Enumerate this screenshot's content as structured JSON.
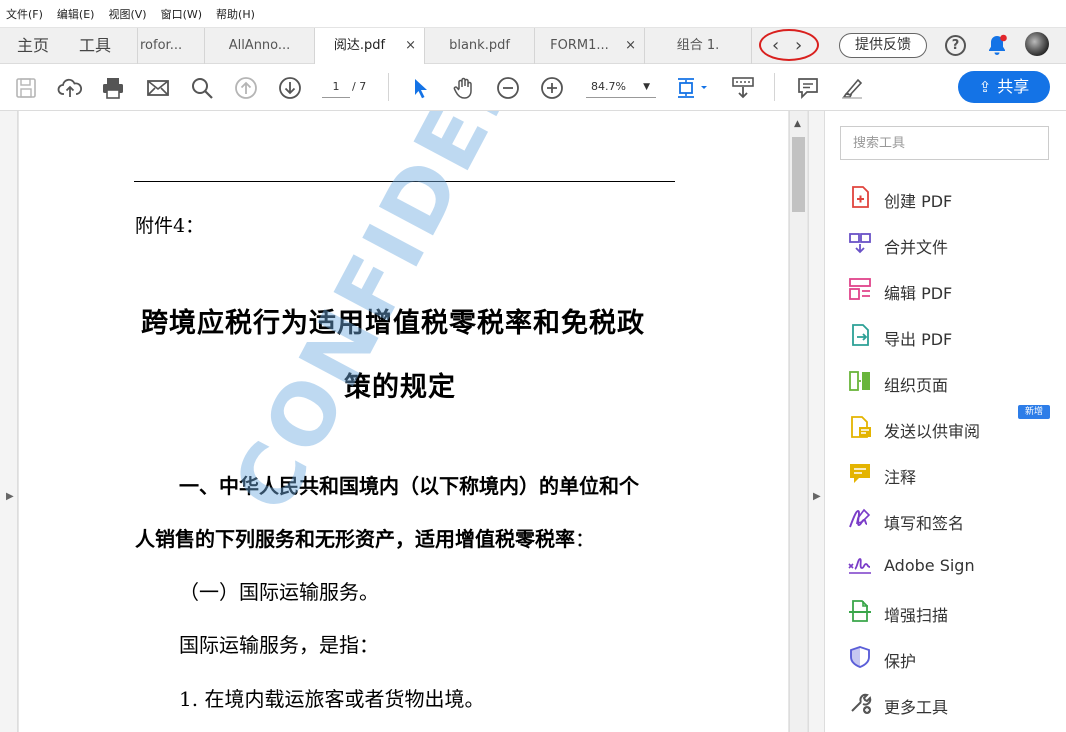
{
  "menu": [
    "文件(F)",
    "编辑(E)",
    "视图(V)",
    "窗口(W)",
    "帮助(H)"
  ],
  "nav_tabs": [
    "主页",
    "工具"
  ],
  "doc_tabs": [
    {
      "label": "rofor...",
      "close": ""
    },
    {
      "label": "AllAnno...",
      "close": ""
    },
    {
      "label": "阅达.pdf",
      "close": "×"
    },
    {
      "label": "blank.pdf",
      "close": ""
    },
    {
      "label": "FORM1...",
      "close": "×"
    },
    {
      "label": "组合 1.",
      "close": ""
    }
  ],
  "tab_arrows": {
    "prev": "‹",
    "next": "›"
  },
  "header": {
    "feedback": "提供反馈",
    "help": "?",
    "share": "共享"
  },
  "toolbar": {
    "page_current": "1",
    "page_total": "/ 7",
    "zoom": "84.7%"
  },
  "document": {
    "annex": "附件4：",
    "title_line1": "跨境应税行为适用增值税零税率和免税政",
    "title_line2": "策的规定",
    "heading_line1": "一、中华人民共和国境内（以下称境内）的单位和个",
    "heading_line2": "人销售的下列服务和无形资产，适用增值税零税率",
    "heading_colon": "：",
    "item1": "（一）国际运输服务。",
    "item2": "国际运输服务，是指：",
    "item3": "1. 在境内载运旅客或者货物出境。",
    "watermark": "CONFIDENTIAL"
  },
  "tools_panel": {
    "search_placeholder": "搜索工具",
    "items": [
      {
        "label": "创建 PDF",
        "icon": "create-pdf-icon",
        "color": "#e0443d"
      },
      {
        "label": "合并文件",
        "icon": "combine-files-icon",
        "color": "#6a52c7"
      },
      {
        "label": "编辑 PDF",
        "icon": "edit-pdf-icon",
        "color": "#e0448a"
      },
      {
        "label": "导出 PDF",
        "icon": "export-pdf-icon",
        "color": "#2ca096"
      },
      {
        "label": "组织页面",
        "icon": "organize-pages-icon",
        "color": "#69b53b"
      },
      {
        "label": "发送以供审阅",
        "icon": "send-review-icon",
        "color": "#e4b400"
      },
      {
        "label": "注释",
        "icon": "comment-icon",
        "color": "#e4b400"
      },
      {
        "label": "填写和签名",
        "icon": "fill-sign-icon",
        "color": "#7a3cc8"
      },
      {
        "label": "Adobe Sign",
        "icon": "adobe-sign-icon",
        "color": "#7a3cc8"
      },
      {
        "label": "增强扫描",
        "icon": "enhance-scan-icon",
        "color": "#3aa64a"
      },
      {
        "label": "保护",
        "icon": "protect-icon",
        "color": "#5b5fd8"
      },
      {
        "label": "更多工具",
        "icon": "more-tools-icon",
        "color": "#555555"
      }
    ],
    "new_badge": "新增"
  },
  "colors": {
    "accent": "#1473e6",
    "annotation_circle": "#d9201e"
  }
}
